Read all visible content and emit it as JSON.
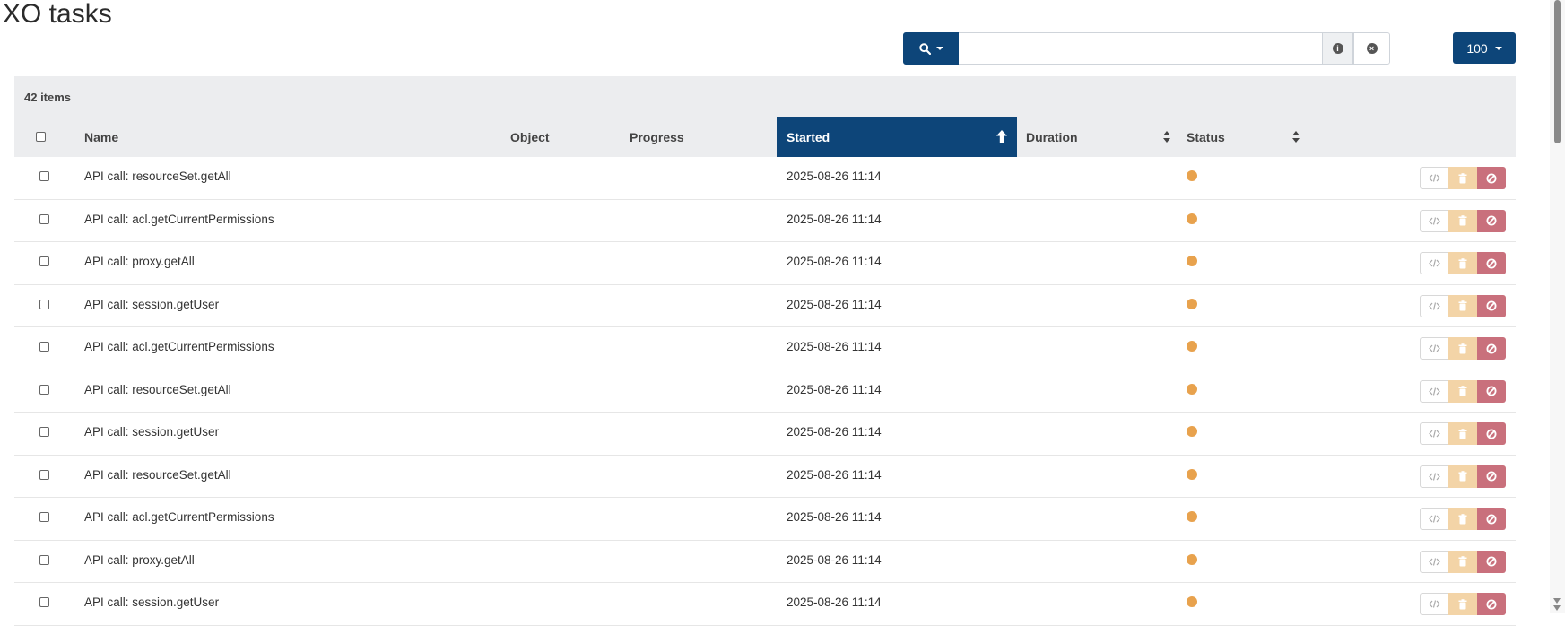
{
  "page": {
    "title": "XO tasks"
  },
  "search": {
    "value": "",
    "placeholder": ""
  },
  "page_size": {
    "label": "100"
  },
  "table": {
    "items_count": "42 items",
    "columns": {
      "name": "Name",
      "object": "Object",
      "progress": "Progress",
      "started": "Started",
      "duration": "Duration",
      "status": "Status"
    },
    "sorted_column": "started",
    "sort_direction": "ascending",
    "rows": [
      {
        "name": "API call: resourceSet.getAll",
        "started": "2025-08-26 11:14",
        "status_color": "#e8a24d"
      },
      {
        "name": "API call: acl.getCurrentPermissions",
        "started": "2025-08-26 11:14",
        "status_color": "#e8a24d"
      },
      {
        "name": "API call: proxy.getAll",
        "started": "2025-08-26 11:14",
        "status_color": "#e8a24d"
      },
      {
        "name": "API call: session.getUser",
        "started": "2025-08-26 11:14",
        "status_color": "#e8a24d"
      },
      {
        "name": "API call: acl.getCurrentPermissions",
        "started": "2025-08-26 11:14",
        "status_color": "#e8a24d"
      },
      {
        "name": "API call: resourceSet.getAll",
        "started": "2025-08-26 11:14",
        "status_color": "#e8a24d"
      },
      {
        "name": "API call: session.getUser",
        "started": "2025-08-26 11:14",
        "status_color": "#e8a24d"
      },
      {
        "name": "API call: resourceSet.getAll",
        "started": "2025-08-26 11:14",
        "status_color": "#e8a24d"
      },
      {
        "name": "API call: acl.getCurrentPermissions",
        "started": "2025-08-26 11:14",
        "status_color": "#e8a24d"
      },
      {
        "name": "API call: proxy.getAll",
        "started": "2025-08-26 11:14",
        "status_color": "#e8a24d"
      },
      {
        "name": "API call: session.getUser",
        "started": "2025-08-26 11:14",
        "status_color": "#e8a24d"
      }
    ]
  },
  "icons": {
    "search": "search-icon",
    "info": "info-icon",
    "clear": "clear-icon",
    "code": "code-icon",
    "delete": "trash-icon",
    "cancel": "cancel-icon"
  },
  "colors": {
    "primary": "#0d4579",
    "header_bg": "#ecedef",
    "status_pending": "#e8a24d",
    "delete": "#f3d4a7",
    "cancel": "#c9707c"
  }
}
